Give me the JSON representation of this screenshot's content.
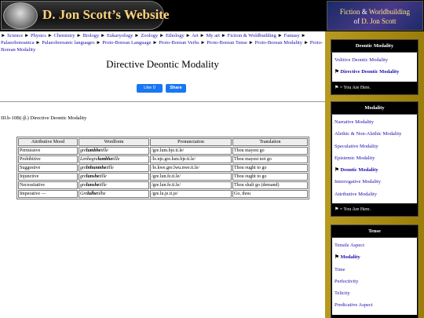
{
  "header": {
    "site_title": "D. Jon Scott’s Website",
    "fiction_banner": {
      "line1_a": "Fiction",
      "line1_amp": " & ",
      "line1_b": "Worldbuilding",
      "line2_a": "of ",
      "line2_b": "D. Jon Scott"
    }
  },
  "breadcrumb": [
    "Science",
    "Physics",
    "Chemistry",
    "Biology",
    "Eukaryology",
    "Zoology",
    "Ethology",
    "Art",
    "My art",
    "Fiction & Woldbuilding",
    "Fantasy",
    "Palaeoboreanica",
    "Palaeoboreanic languages",
    "Proto-Borean Language",
    "Proto-Borean Verbs",
    "Proto-Borean Tense",
    "Proto-Borean Modality",
    "Proto-Borean Modality"
  ],
  "breadcrumb_sep": "►",
  "page": {
    "title": "Directive Deontic Modality",
    "like_label": "Like 0",
    "share_label": "Share",
    "section_id": "III.b-10B(-β.) Directive Deontic Modality"
  },
  "table": {
    "headers": [
      "Attributive Mood",
      "Wordform",
      "Pronunciation",
      "Translation"
    ],
    "rows": [
      {
        "mood": "Permissive",
        "pre": "gre",
        "bold": "lumbhe",
        "post": "tille",
        "pron": "/gre.lum.bje.ti.le/",
        "trans": "Thou mayest go"
      },
      {
        "mood": "Prohibitive",
        "pre": "Lenhegre",
        "bold": "lumbhe",
        "post": "tille",
        "pron": "/le.nje.gre.lum.bje.ti.le/",
        "trans": "Thou mayest not go"
      },
      {
        "mood": "Suggestive",
        "pre": "gre",
        "bold": "lnhunmhe",
        "post": "tille",
        "pron": "/le.kwe.gre.lwu.nwe.ti.le/",
        "trans": "Thou ought to go"
      },
      {
        "mood": "Injunctive",
        "pre": "gre",
        "bold": "lunshe",
        "post": "tille",
        "pron": "/gre.lun.fe.ti.le/",
        "trans": "Thou ought to go"
      },
      {
        "mood": "Necessitative",
        "pre": "gre",
        "bold": "lunshe",
        "post": "tille",
        "pron": "/gre.lun.fe.ti.le/",
        "trans": "Thou shalt go (demand)"
      },
      {
        "mood": "Imperative —",
        "pre": "Gre",
        "bold": "lulhe",
        "post": "tilhe",
        "pron": "/gre.lu.je.ti.je/",
        "trans": "Go, thou"
      }
    ]
  },
  "sidebar": {
    "you_are_here": "⚑ = You Are Here.",
    "boxes": [
      {
        "title": "Deontic Modality",
        "items": [
          {
            "label": "Volitive Deontic Modality",
            "current": false
          },
          {
            "label": "Directive Deontic Modality",
            "current": true
          }
        ]
      },
      {
        "title": "Modality",
        "items": [
          {
            "label": "Narrative Modality",
            "current": false
          },
          {
            "label": "Alethic & Non-Alethic Modality",
            "current": false
          },
          {
            "label": "Speculative Modality",
            "current": false
          },
          {
            "label": "Epistemic Modality",
            "current": false
          },
          {
            "label": "Deontic Modality",
            "current": true
          },
          {
            "label": "Interrogative Modality",
            "current": false
          },
          {
            "label": "Attributive Modality",
            "current": false
          }
        ]
      },
      {
        "title": "Tense",
        "items": [
          {
            "label": "Tensile Aspect",
            "current": false
          },
          {
            "label": "Modality",
            "current": true
          },
          {
            "label": "Time",
            "current": false
          },
          {
            "label": "Perfectivity",
            "current": false
          },
          {
            "label": "Telicity",
            "current": false
          },
          {
            "label": "Predicative Aspect",
            "current": false
          }
        ]
      }
    ]
  },
  "colors": {
    "header_bg": "#000000",
    "sidebar_bg": "#a88800",
    "link": "#1a0dab",
    "facebook": "#1877f2"
  },
  "icons": {
    "flag": "flag-icon",
    "breadcrumb_sep": "arrow-right-icon"
  }
}
